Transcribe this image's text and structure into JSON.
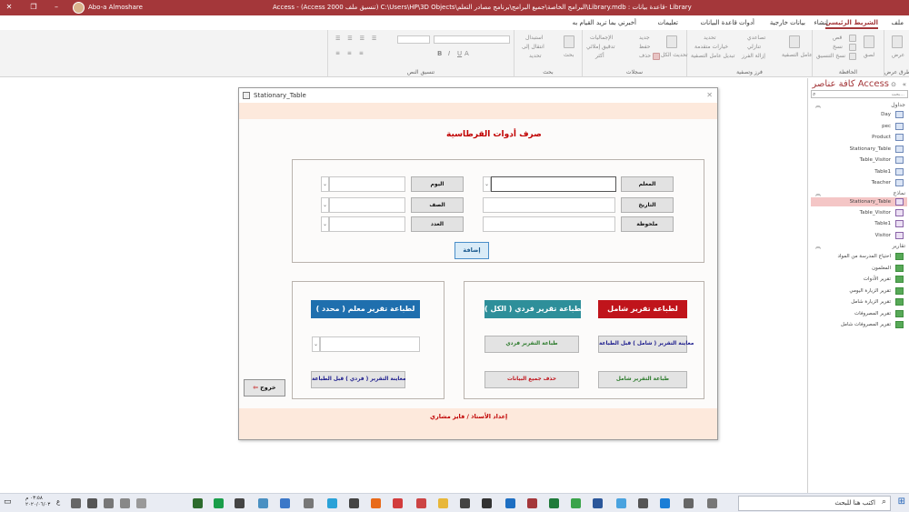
{
  "titlebar": {
    "title": "Access  -  (Access 2000 تنسيق ملف)  C:\\Users\\HP\\3D Objects\\البرامج الخاصة\\جميع البرامج\\برنامج مصادر التعلم\\Library.mdb : قاعدة بيانات-  Library",
    "user": "Abo-a Almoshare",
    "accent": "#a4373a"
  },
  "ribbon_tabs": [
    "ملف",
    "الشريط الرئيسي",
    "إنشاء",
    "بيانات خارجية",
    "أدوات قاعدة البيانات",
    "تعليمات",
    "أخبرني بما تريد القيام به"
  ],
  "ribbon_groups": {
    "views": "طرق عرض",
    "clipboard": "الحافظة",
    "sort_filter": "فرز وتصفية",
    "records": "سجلات",
    "find": "بحث",
    "text_format": "تنسيق النص"
  },
  "ribbon_items": {
    "view": "عرض",
    "paste": "لصق",
    "cut": "قص",
    "copy": "نسخ",
    "format_painter": "نسخ التنسيق",
    "filter": "عامل التصفية",
    "ascending": "تصاعدي",
    "descending": "تنازلي",
    "remove_sort": "إزالة الفرز",
    "selection": "تحديد",
    "advanced": "خيارات متقدمة",
    "toggle_filter": "تبديل عامل التصفية",
    "refresh_all": "تحديث الكل",
    "new": "جديد",
    "save": "حفظ",
    "delete": "حذف",
    "totals": "الإجماليات",
    "spelling": "تدقيق إملائي",
    "more": "أكثر",
    "find": "بحث",
    "replace": "استبدال",
    "goto": "انتقال إلى",
    "select": "تحديد"
  },
  "nav": {
    "title": "كافة عناصر Access",
    "search_placeholder": "بحث...",
    "sections": [
      {
        "name": "جداول",
        "items": [
          "Day",
          "pec",
          "Product",
          "Stationary_Table",
          "Table_Visitor",
          "Table1",
          "Teacher"
        ]
      },
      {
        "name": "نماذج",
        "items": [
          "Stationary_Table",
          "Table_Visitor",
          "Table1",
          "Visitor"
        ]
      },
      {
        "name": "تقارير",
        "items": [
          "احتياج المدرسة من المواد",
          "المعلمون",
          "تقرير الأدوات",
          "تقرير الزيارة اليومي",
          "تقرير الزيارة شامل",
          "تقرير المصروفات",
          "تقرير المصروفات شامل"
        ]
      }
    ],
    "selected": "Stationary_Table"
  },
  "form": {
    "window_title": "Stationary_Table",
    "heading": "صرف أدوات القرطاسية",
    "fields": {
      "teacher": "المعلم",
      "day": "اليوم",
      "date": "التاريخ",
      "class": "الصف",
      "note": "ملحوظة",
      "count": "العدد"
    },
    "add_button": "إضافة",
    "report_headers": {
      "comprehensive": "لطباعة تقرير شامل",
      "individual_all": "لطباعة تقرير فردي ( الكل )",
      "teacher_specific": "لطباعة تقرير معلم ( محدد )"
    },
    "actions": {
      "preview_comprehensive": "معاينة التقرير ( شامل ) قبل الطباعة",
      "print_individual": "طباعة التقرير فردي",
      "print_comprehensive": "طباعة التقرير شامل",
      "delete_all": "حذف جميع البيانات",
      "preview_individual": "معاينة التقرير ( فردي ) قبل الطباعة"
    },
    "exit_button": "خروج",
    "footer": "إعداد الأستاذ / فايز مشاري"
  },
  "colors": {
    "red_header": "#c0141b",
    "teal_header": "#2e8f9a",
    "blue_header": "#1f6fae",
    "band": "#fde9dc",
    "heading_red": "#c00000"
  },
  "taskbar": {
    "search_placeholder": "اكتب هنا للبحث",
    "time": "٠٣:٥٨ م",
    "date": "٢٠٢٠/٠٦/٠٣",
    "lang": "ع"
  }
}
